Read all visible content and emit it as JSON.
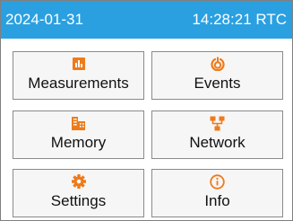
{
  "status_bar": {
    "date": "2024-01-31",
    "time": "14:28:21 RTC",
    "background": "#2aa0e1"
  },
  "menu": {
    "icon_color": "#ee7b1a",
    "buttons": [
      {
        "label": "Measurements",
        "icon": "bar-chart-icon"
      },
      {
        "label": "Events",
        "icon": "events-icon"
      },
      {
        "label": "Memory",
        "icon": "memory-icon"
      },
      {
        "label": "Network",
        "icon": "network-icon"
      },
      {
        "label": "Settings",
        "icon": "gear-icon"
      },
      {
        "label": "Info",
        "icon": "info-icon"
      }
    ]
  }
}
